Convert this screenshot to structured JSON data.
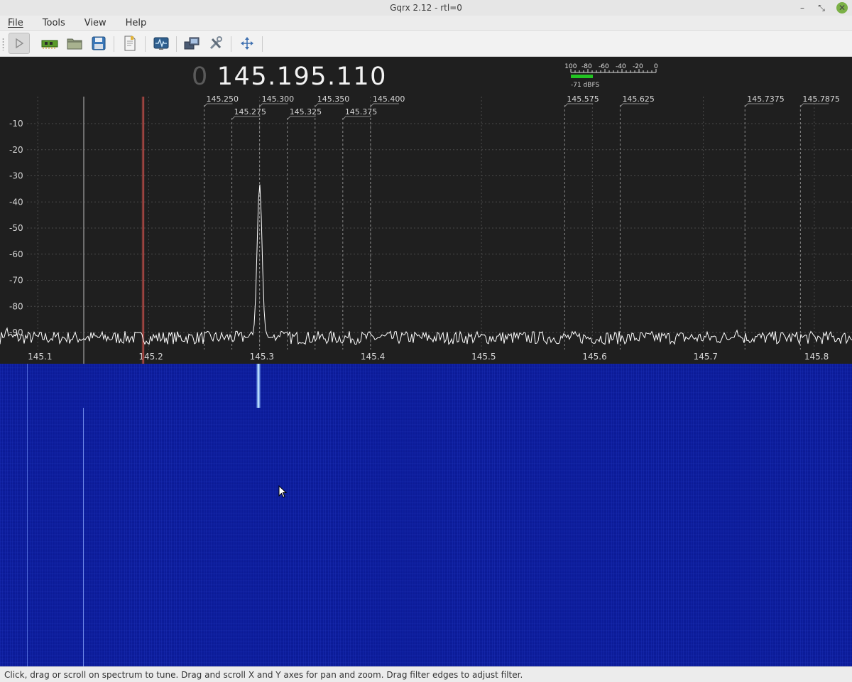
{
  "window": {
    "title": "Gqrx 2.12 - rtl=0",
    "minimize_glyph": "–",
    "maximize_glyph": "⤡",
    "close_glyph": "✕"
  },
  "menu": {
    "items": [
      "File",
      "Tools",
      "View",
      "Help"
    ]
  },
  "toolbar": {
    "buttons": [
      {
        "name": "start-dsp-button",
        "icon": "play-icon"
      },
      {
        "name": "io-devices-button",
        "icon": "hardware-board-icon"
      },
      {
        "name": "load-settings-button",
        "icon": "folder-icon"
      },
      {
        "name": "save-settings-button",
        "icon": "floppy-disk-icon"
      },
      {
        "name": "bookmarks-button",
        "icon": "document-icon"
      },
      {
        "name": "iq-tool-button",
        "icon": "waveform-monitor-icon"
      },
      {
        "name": "remote-control-button",
        "icon": "computers-icon"
      },
      {
        "name": "dxc-options-button",
        "icon": "tools-icon"
      },
      {
        "name": "dock-layout-button",
        "icon": "arrows-expand-icon"
      }
    ]
  },
  "frequency": {
    "lead_digit": "0",
    "display": "145.195.110"
  },
  "meter": {
    "scale_labels": [
      "-100",
      "-80",
      "-60",
      "-40",
      "-20",
      "0"
    ],
    "readout": "-71 dBFS",
    "level_dbfs": -71,
    "bar_color": "#22c422"
  },
  "chart_data": {
    "type": "line",
    "xlim": [
      145.066,
      145.834
    ],
    "ylim": [
      -100,
      0
    ],
    "x_ticks": [
      "145.1",
      "145.2",
      "145.3",
      "145.4",
      "145.5",
      "145.6",
      "145.7",
      "145.8"
    ],
    "x_tick_values": [
      145.1,
      145.2,
      145.3,
      145.4,
      145.5,
      145.6,
      145.7,
      145.8
    ],
    "y_ticks": [
      "-10",
      "-20",
      "-30",
      "-40",
      "-50",
      "-60",
      "-70",
      "-80",
      "-90"
    ],
    "y_tick_values": [
      -10,
      -20,
      -30,
      -40,
      -50,
      -60,
      -70,
      -80,
      -90
    ],
    "grid": true,
    "noise_floor_db": -92,
    "peaks": [
      {
        "freq": 145.3,
        "level_db": -33
      },
      {
        "freq": 145.32,
        "level_db": -89
      },
      {
        "freq": 145.072,
        "level_db": -88
      },
      {
        "freq": 145.73,
        "level_db": -89
      }
    ],
    "tuned_freq": 145.195,
    "bookmarks": [
      {
        "label": "145.250",
        "freq": 145.25,
        "row": 1
      },
      {
        "label": "145.275",
        "freq": 145.275,
        "row": 2
      },
      {
        "label": "145.300",
        "freq": 145.3,
        "row": 1
      },
      {
        "label": "145.325",
        "freq": 145.325,
        "row": 2
      },
      {
        "label": "145.350",
        "freq": 145.35,
        "row": 1
      },
      {
        "label": "145.375",
        "freq": 145.375,
        "row": 2
      },
      {
        "label": "145.400",
        "freq": 145.4,
        "row": 1
      },
      {
        "label": "145.575",
        "freq": 145.575,
        "row": 1
      },
      {
        "label": "145.625",
        "freq": 145.625,
        "row": 1
      },
      {
        "label": "145.7375",
        "freq": 145.7375,
        "row": 1
      },
      {
        "label": "145.7875",
        "freq": 145.7875,
        "row": 1
      }
    ],
    "colors": {
      "trace": "#ffffff",
      "grid": "#4a4a4a",
      "tuned_line": "#d8554f",
      "bookmark": "#8a8a8a",
      "axis_text": "#d6d6d6"
    }
  },
  "waterfall": {
    "colors": {
      "background": "#0c1c9a",
      "signal": "#e8f4ff"
    }
  },
  "status": {
    "text": "Click, drag or scroll on spectrum to tune. Drag and scroll X and Y axes for pan and zoom. Drag filter edges to adjust filter."
  }
}
